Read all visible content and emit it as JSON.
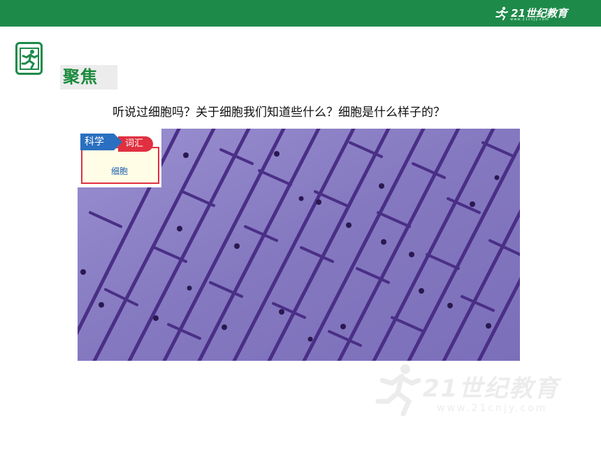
{
  "header": {
    "brand": "21世纪教育",
    "brand_url": "www.21cnjy.com"
  },
  "section": {
    "focus_label": "聚焦"
  },
  "question": "听说过细胞吗？关于细胞我们知道些什么？细胞是什么样子的？",
  "vocab_card": {
    "category": "科学",
    "type": "词汇",
    "term": "细胞"
  },
  "image": {
    "subject": "micrograph-cells",
    "background_color": "#8a7ec4",
    "wall_color": "#4a2f86",
    "nucleus_color": "#2a1850"
  },
  "watermark": {
    "brand": "21世纪教育",
    "url": "www.21cnjy.com"
  },
  "colors": {
    "top_bar": "#1e8a4a",
    "focus_text": "#1a8a3c",
    "science_tag": "#2a6fc0",
    "vocab_tag": "#e03040"
  }
}
